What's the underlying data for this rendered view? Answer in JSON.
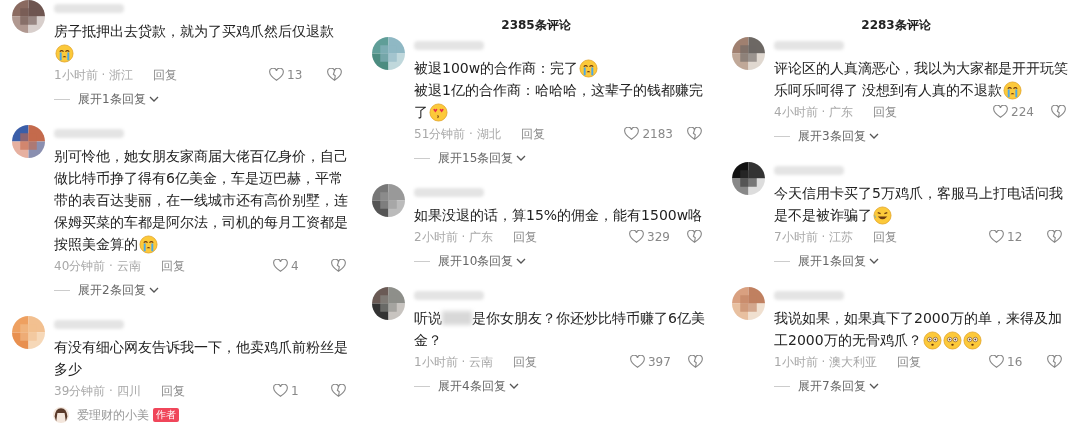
{
  "panels": [
    {
      "comments": [
        {
          "lines": [
            [
              {
                "kind": "text",
                "text": "房子抵押出去贷款，就为了买鸡爪然后仅退款"
              }
            ],
            [
              {
                "kind": "crying"
              }
            ]
          ],
          "meta": "1小时前 · 浙江",
          "reply": "回复",
          "likes": "13",
          "expand": "展开1条回复"
        },
        {
          "lines": [
            [
              {
                "kind": "text",
                "text": "别可怜他，她女朋友家商届大佬百亿身价，自己"
              }
            ],
            [
              {
                "kind": "text",
                "text": "做比特币挣了得有6亿美金，车是迈巴赫，平常"
              }
            ],
            [
              {
                "kind": "text",
                "text": "带的表百达斐丽，在一线城市还有高价别墅，连"
              }
            ],
            [
              {
                "kind": "text",
                "text": "保姆买菜的车都是阿尔法，司机的每月工资都是"
              }
            ],
            [
              {
                "kind": "text",
                "text": "按照美金算的"
              },
              {
                "kind": "crying"
              }
            ]
          ],
          "meta": "40分钟前 · 云南",
          "reply": "回复",
          "likes": "4",
          "expand": "展开2条回复"
        },
        {
          "lines": [
            [
              {
                "kind": "text",
                "text": "有没有细心网友告诉我一下，他卖鸡爪前粉丝是"
              }
            ],
            [
              {
                "kind": "text",
                "text": "多少"
              }
            ]
          ],
          "meta": "39分钟前 · 四川",
          "reply": "回复",
          "likes": "1"
        }
      ],
      "author_reply": {
        "name": "爱理财的小美",
        "badge": "作者"
      }
    },
    {
      "title": "2385条评论",
      "comments": [
        {
          "lines": [
            [
              {
                "kind": "text",
                "text": "被退100w的合作商：完了"
              },
              {
                "kind": "crying"
              }
            ],
            [
              {
                "kind": "text",
                "text": "被退1亿的合作商：哈哈哈，这辈子的钱都赚完"
              }
            ],
            [
              {
                "kind": "text",
                "text": "了"
              },
              {
                "kind": "hearts"
              }
            ]
          ],
          "meta": "51分钟前 · 湖北",
          "reply": "回复",
          "likes": "2183",
          "expand": "展开15条回复"
        },
        {
          "lines": [
            [
              {
                "kind": "text",
                "text": "如果没退的话，算15%的佣金，能有1500w咯"
              }
            ]
          ],
          "meta": "2小时前 · 广东",
          "reply": "回复",
          "likes": "329",
          "expand": "展开10条回复"
        },
        {
          "lines": [
            [
              {
                "kind": "text",
                "text": "听说"
              },
              {
                "kind": "blur"
              },
              {
                "kind": "text",
                "text": "是你女朋友？你还炒比特币赚了6亿美"
              }
            ],
            [
              {
                "kind": "text",
                "text": "金？"
              }
            ]
          ],
          "meta": "1小时前 · 云南",
          "reply": "回复",
          "likes": "397",
          "expand": "展开4条回复"
        }
      ]
    },
    {
      "title": "2283条评论",
      "comments": [
        {
          "lines": [
            [
              {
                "kind": "text",
                "text": "评论区的人真滴恶心，我以为大家都是开开玩笑"
              }
            ],
            [
              {
                "kind": "text",
                "text": "乐呵乐呵得了 没想到有人真的不退款"
              },
              {
                "kind": "crying"
              }
            ]
          ],
          "meta": "4小时前 · 广东",
          "reply": "回复",
          "likes": "224",
          "expand": "展开3条回复"
        },
        {
          "lines": [
            [
              {
                "kind": "text",
                "text": "今天信用卡买了5万鸡爪，客服马上打电话问我"
              }
            ],
            [
              {
                "kind": "text",
                "text": "是不是被诈骗了"
              },
              {
                "kind": "laugh"
              }
            ]
          ],
          "meta": "7小时前 · 江苏",
          "reply": "回复",
          "likes": "12",
          "expand": "展开1条回复"
        },
        {
          "lines": [
            [
              {
                "kind": "text",
                "text": "我说如果，如果真下了2000万的单，来得及加"
              }
            ],
            [
              {
                "kind": "text",
                "text": "工2000万的无骨鸡爪？"
              },
              {
                "kind": "pleading"
              },
              {
                "kind": "pleading"
              },
              {
                "kind": "pleading"
              }
            ]
          ],
          "meta": "1小时前 · 澳大利亚",
          "reply": "回复",
          "likes": "16",
          "expand": "展开7条回复"
        }
      ]
    }
  ]
}
